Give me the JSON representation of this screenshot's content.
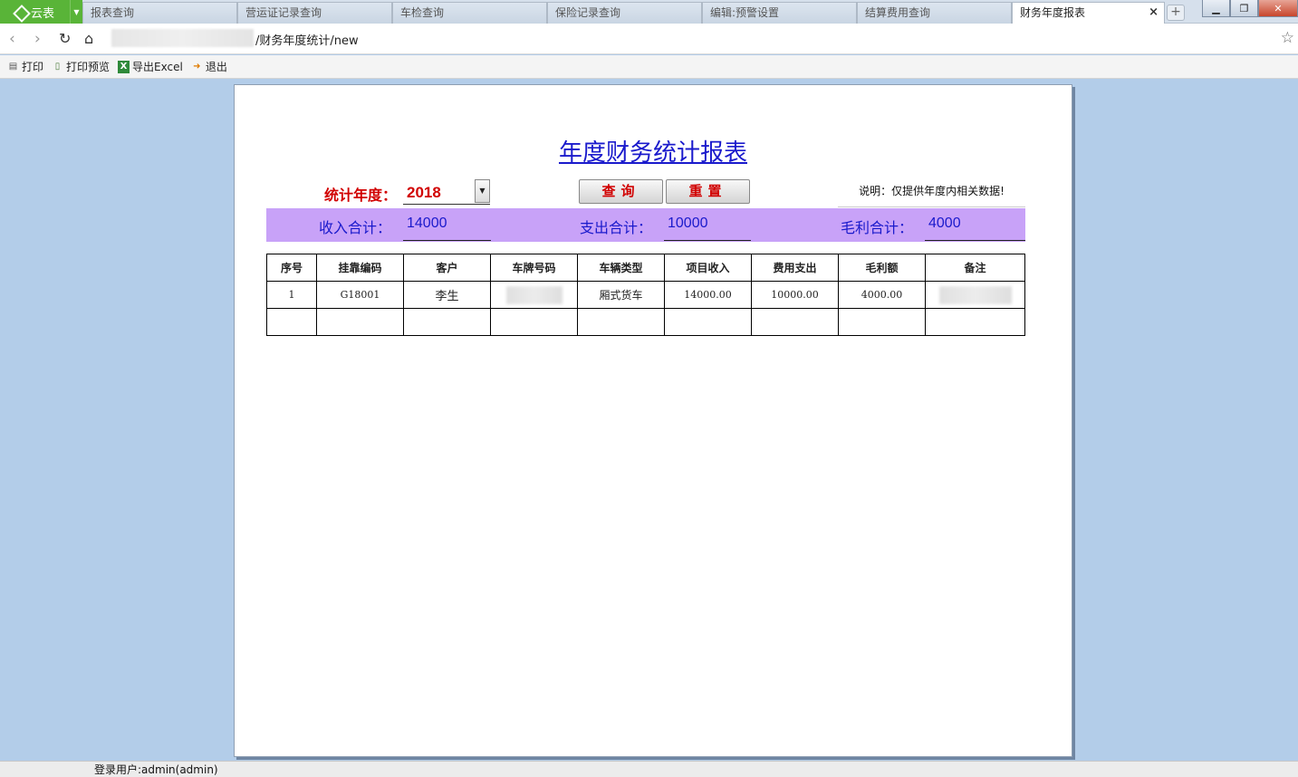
{
  "browser": {
    "brand_label": "云表",
    "tabs": [
      {
        "label": "报表查询"
      },
      {
        "label": "营运证记录查询"
      },
      {
        "label": "车检查询"
      },
      {
        "label": "保险记录查询"
      },
      {
        "label": "编辑:预警设置"
      },
      {
        "label": "结算费用查询"
      },
      {
        "label": "财务年度报表"
      }
    ],
    "url_suffix": "/财务年度统计/new"
  },
  "toolbar": {
    "print": "打印",
    "print_preview": "打印预览",
    "export_excel": "导出Excel",
    "logout": "退出"
  },
  "report": {
    "title": "年度财务统计报表",
    "year_label": "统计年度：",
    "year_value": "2018",
    "query_button": "查询",
    "reset_button": "重置",
    "note": "说明：仅提供年度内相关数据!",
    "summary": {
      "income_label": "收入合计：",
      "income_value": "14000",
      "expense_label": "支出合计：",
      "expense_value": "10000",
      "profit_label": "毛利合计：",
      "profit_value": "4000"
    },
    "table": {
      "headers": [
        "序号",
        "挂靠编码",
        "客户",
        "车牌号码",
        "车辆类型",
        "项目收入",
        "费用支出",
        "毛利额",
        "备注"
      ],
      "rows": [
        [
          "1",
          "G18001",
          "李生",
          "",
          "厢式货车",
          "14000.00",
          "10000.00",
          "4000.00",
          ""
        ]
      ]
    }
  },
  "status": {
    "login_user": "登录用户:admin(admin)"
  },
  "colors": {
    "summary_bg": "#c8a2f8",
    "title_blue": "#1a1acc",
    "label_red": "#d10000",
    "desktop_bg": "#b3cde9"
  }
}
